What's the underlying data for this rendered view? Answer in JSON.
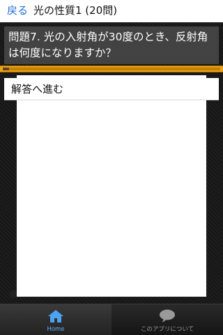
{
  "header": {
    "back_label": "戻る",
    "title": "光の性質1 (20問)"
  },
  "question": {
    "text": "問題7. 光の入射角が30度のとき、反射角は何度になりますか？"
  },
  "progress": {
    "fraction": 0.03
  },
  "answer": {
    "reveal_label": "解答へ進む"
  },
  "tabbar": {
    "tabs": [
      {
        "label": "Home",
        "icon": "home-icon",
        "active": true
      },
      {
        "label": "このアプリについて",
        "icon": "speech-bubble-icon",
        "active": false
      }
    ]
  },
  "colors": {
    "accent": "#1e6fd0",
    "progress": "#e9a21a",
    "tab_active": "#5bb0ff"
  }
}
